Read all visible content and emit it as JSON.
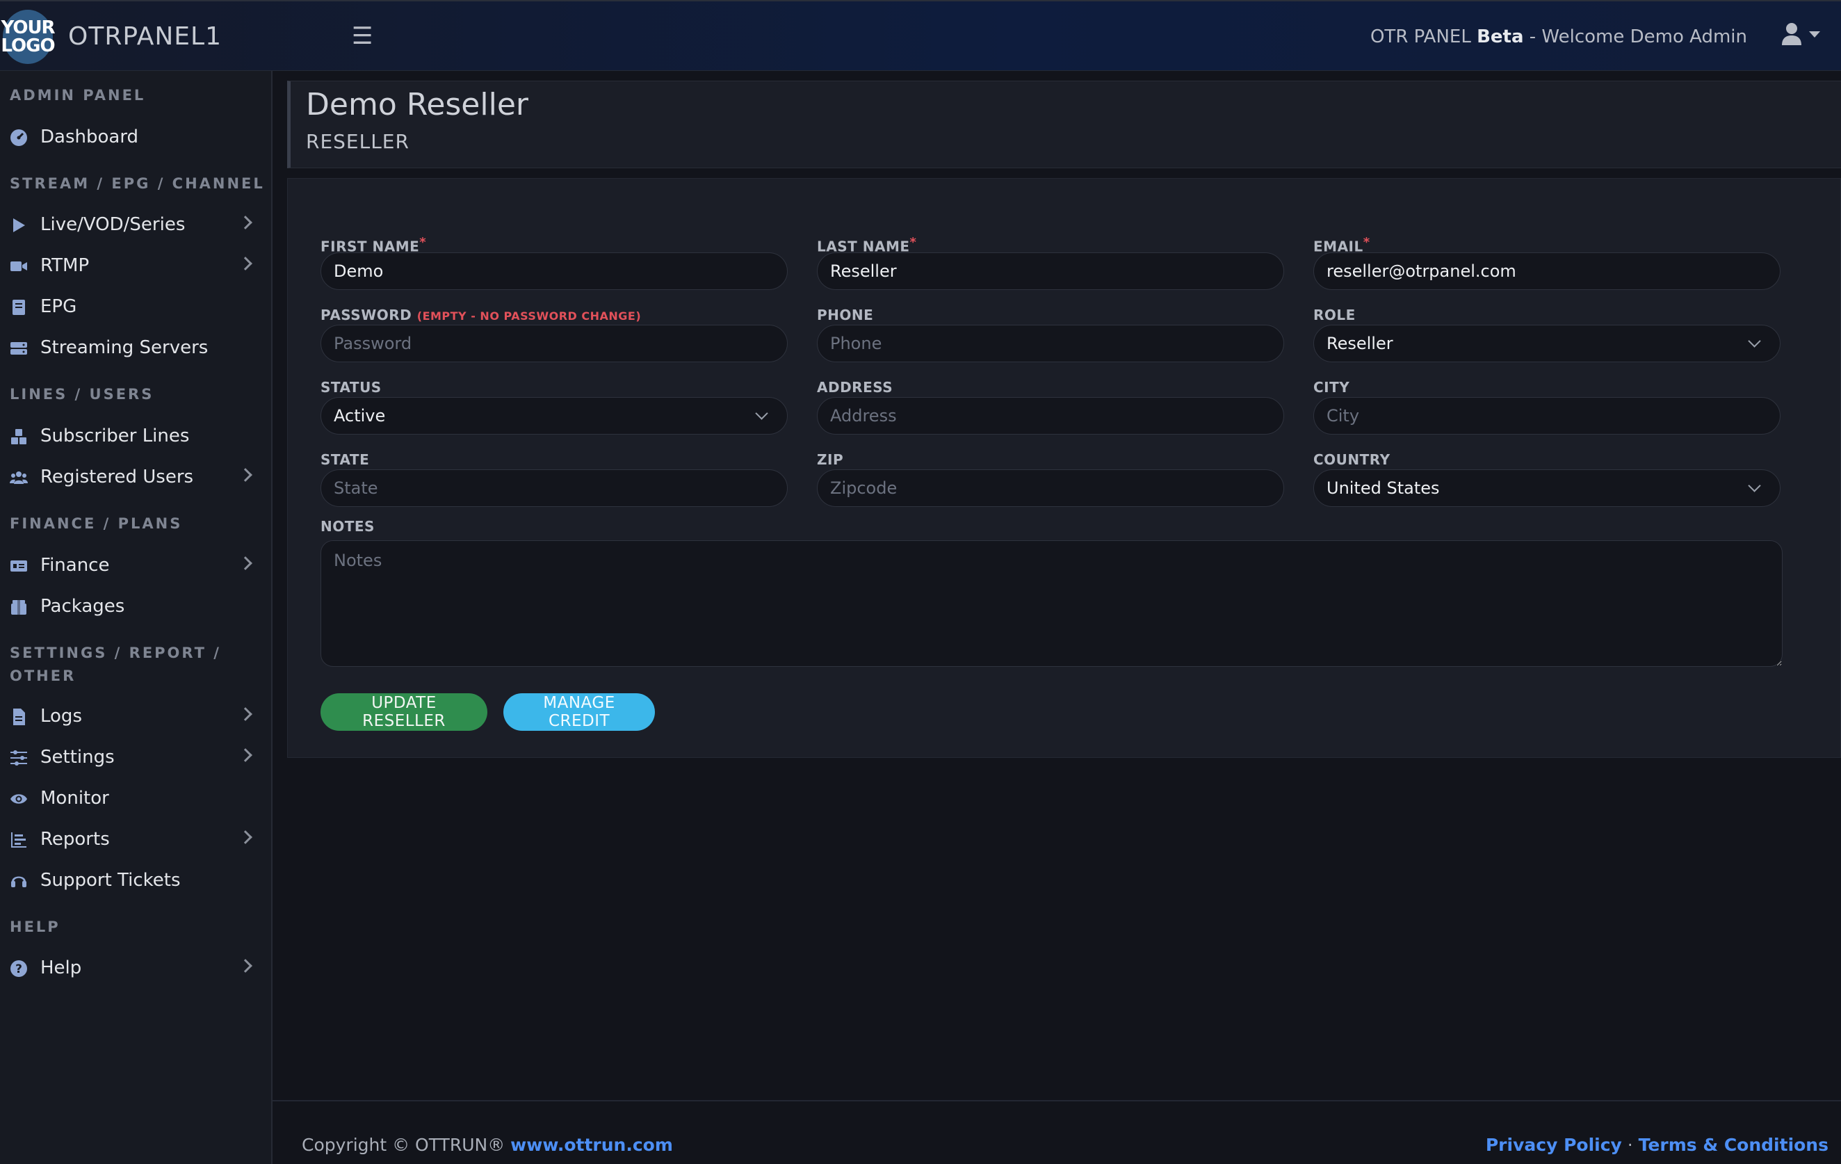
{
  "header": {
    "logo_line1": "YOUR",
    "logo_line2": "LOGO",
    "brand": "OTRPANEL1",
    "welcome_prefix": "OTR PANEL ",
    "welcome_beta": "Beta",
    "welcome_suffix": " - Welcome Demo Admin"
  },
  "sidebar": {
    "sections": {
      "admin": "ADMIN PANEL",
      "stream": "STREAM / EPG / CHANNEL",
      "lines": "LINES / USERS",
      "finance": "FINANCE / PLANS",
      "settings_line1": "SETTINGS / REPORT /",
      "settings_line2": "OTHER",
      "help": "HELP"
    },
    "items": {
      "dashboard": "Dashboard",
      "live": "Live/VOD/Series",
      "rtmp": "RTMP",
      "epg": "EPG",
      "streaming": "Streaming Servers",
      "subscriber": "Subscriber Lines",
      "registered": "Registered Users",
      "finance": "Finance",
      "packages": "Packages",
      "logs": "Logs",
      "settings": "Settings",
      "monitor": "Monitor",
      "reports": "Reports",
      "support": "Support Tickets",
      "help": "Help"
    }
  },
  "page": {
    "title": "Demo Reseller",
    "subtitle": "RESELLER"
  },
  "form": {
    "first_name": {
      "label": "FIRST NAME",
      "value": "Demo"
    },
    "last_name": {
      "label": "LAST NAME",
      "value": "Reseller"
    },
    "email": {
      "label": "EMAIL",
      "value": "reseller@otrpanel.com"
    },
    "password": {
      "label": "PASSWORD",
      "hint": "(EMPTY - NO PASSWORD CHANGE)",
      "placeholder": "Password"
    },
    "phone": {
      "label": "PHONE",
      "placeholder": "Phone"
    },
    "role": {
      "label": "ROLE",
      "value": "Reseller"
    },
    "status": {
      "label": "STATUS",
      "value": "Active"
    },
    "address": {
      "label": "ADDRESS",
      "placeholder": "Address"
    },
    "city": {
      "label": "CITY",
      "placeholder": "City"
    },
    "state": {
      "label": "STATE",
      "placeholder": "State"
    },
    "zip": {
      "label": "ZIP",
      "placeholder": "Zipcode"
    },
    "country": {
      "label": "COUNTRY",
      "value": "United States"
    },
    "notes": {
      "label": "NOTES",
      "placeholder": "Notes"
    },
    "required_mark": "*",
    "update_button": "UPDATE RESELLER",
    "credit_button": "MANAGE CREDIT"
  },
  "footer": {
    "copyright": "Copyright © OTTRUN® ",
    "site_link": "www.ottrun.com",
    "privacy": "Privacy Policy",
    "separator": " · ",
    "terms": "Terms & Conditions"
  },
  "colors": {
    "accent_green": "#2f8d4e",
    "accent_blue": "#3cb7ea",
    "link": "#4d8ff5",
    "required": "#e2515a"
  }
}
